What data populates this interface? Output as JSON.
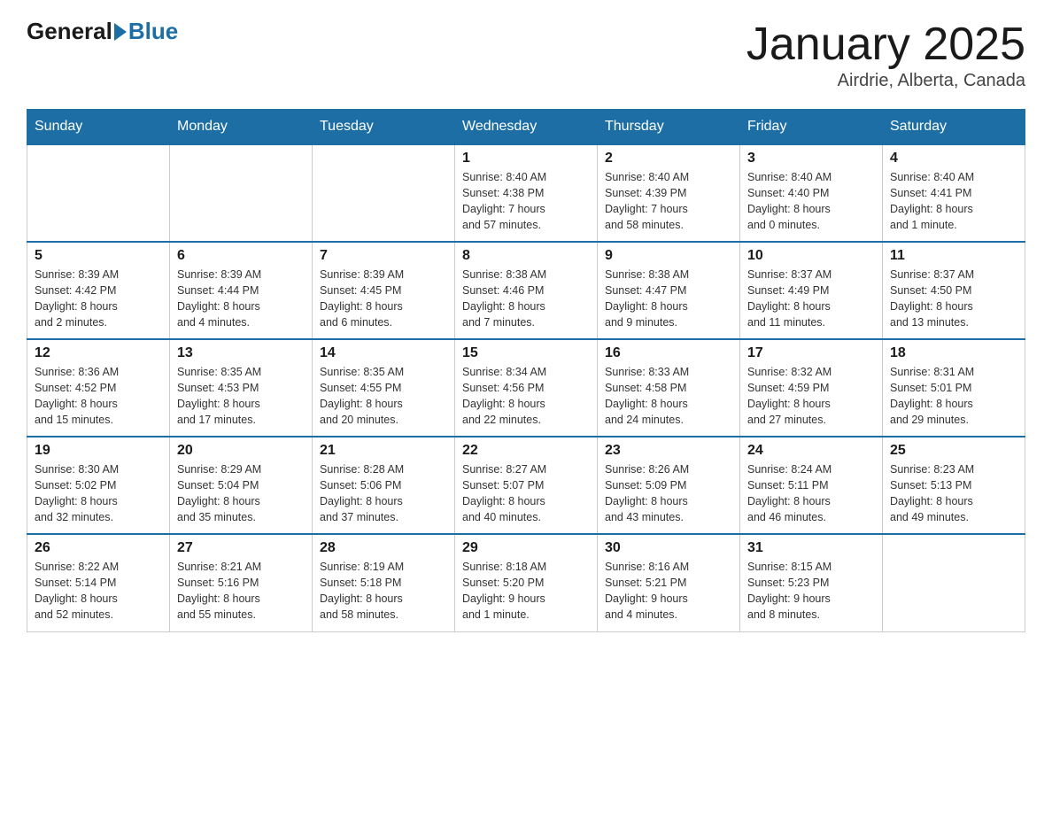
{
  "header": {
    "logo": {
      "general": "General",
      "blue": "Blue"
    },
    "title": "January 2025",
    "location": "Airdrie, Alberta, Canada"
  },
  "weekdays": [
    "Sunday",
    "Monday",
    "Tuesday",
    "Wednesday",
    "Thursday",
    "Friday",
    "Saturday"
  ],
  "weeks": [
    [
      {
        "day": "",
        "info": ""
      },
      {
        "day": "",
        "info": ""
      },
      {
        "day": "",
        "info": ""
      },
      {
        "day": "1",
        "info": "Sunrise: 8:40 AM\nSunset: 4:38 PM\nDaylight: 7 hours\nand 57 minutes."
      },
      {
        "day": "2",
        "info": "Sunrise: 8:40 AM\nSunset: 4:39 PM\nDaylight: 7 hours\nand 58 minutes."
      },
      {
        "day": "3",
        "info": "Sunrise: 8:40 AM\nSunset: 4:40 PM\nDaylight: 8 hours\nand 0 minutes."
      },
      {
        "day": "4",
        "info": "Sunrise: 8:40 AM\nSunset: 4:41 PM\nDaylight: 8 hours\nand 1 minute."
      }
    ],
    [
      {
        "day": "5",
        "info": "Sunrise: 8:39 AM\nSunset: 4:42 PM\nDaylight: 8 hours\nand 2 minutes."
      },
      {
        "day": "6",
        "info": "Sunrise: 8:39 AM\nSunset: 4:44 PM\nDaylight: 8 hours\nand 4 minutes."
      },
      {
        "day": "7",
        "info": "Sunrise: 8:39 AM\nSunset: 4:45 PM\nDaylight: 8 hours\nand 6 minutes."
      },
      {
        "day": "8",
        "info": "Sunrise: 8:38 AM\nSunset: 4:46 PM\nDaylight: 8 hours\nand 7 minutes."
      },
      {
        "day": "9",
        "info": "Sunrise: 8:38 AM\nSunset: 4:47 PM\nDaylight: 8 hours\nand 9 minutes."
      },
      {
        "day": "10",
        "info": "Sunrise: 8:37 AM\nSunset: 4:49 PM\nDaylight: 8 hours\nand 11 minutes."
      },
      {
        "day": "11",
        "info": "Sunrise: 8:37 AM\nSunset: 4:50 PM\nDaylight: 8 hours\nand 13 minutes."
      }
    ],
    [
      {
        "day": "12",
        "info": "Sunrise: 8:36 AM\nSunset: 4:52 PM\nDaylight: 8 hours\nand 15 minutes."
      },
      {
        "day": "13",
        "info": "Sunrise: 8:35 AM\nSunset: 4:53 PM\nDaylight: 8 hours\nand 17 minutes."
      },
      {
        "day": "14",
        "info": "Sunrise: 8:35 AM\nSunset: 4:55 PM\nDaylight: 8 hours\nand 20 minutes."
      },
      {
        "day": "15",
        "info": "Sunrise: 8:34 AM\nSunset: 4:56 PM\nDaylight: 8 hours\nand 22 minutes."
      },
      {
        "day": "16",
        "info": "Sunrise: 8:33 AM\nSunset: 4:58 PM\nDaylight: 8 hours\nand 24 minutes."
      },
      {
        "day": "17",
        "info": "Sunrise: 8:32 AM\nSunset: 4:59 PM\nDaylight: 8 hours\nand 27 minutes."
      },
      {
        "day": "18",
        "info": "Sunrise: 8:31 AM\nSunset: 5:01 PM\nDaylight: 8 hours\nand 29 minutes."
      }
    ],
    [
      {
        "day": "19",
        "info": "Sunrise: 8:30 AM\nSunset: 5:02 PM\nDaylight: 8 hours\nand 32 minutes."
      },
      {
        "day": "20",
        "info": "Sunrise: 8:29 AM\nSunset: 5:04 PM\nDaylight: 8 hours\nand 35 minutes."
      },
      {
        "day": "21",
        "info": "Sunrise: 8:28 AM\nSunset: 5:06 PM\nDaylight: 8 hours\nand 37 minutes."
      },
      {
        "day": "22",
        "info": "Sunrise: 8:27 AM\nSunset: 5:07 PM\nDaylight: 8 hours\nand 40 minutes."
      },
      {
        "day": "23",
        "info": "Sunrise: 8:26 AM\nSunset: 5:09 PM\nDaylight: 8 hours\nand 43 minutes."
      },
      {
        "day": "24",
        "info": "Sunrise: 8:24 AM\nSunset: 5:11 PM\nDaylight: 8 hours\nand 46 minutes."
      },
      {
        "day": "25",
        "info": "Sunrise: 8:23 AM\nSunset: 5:13 PM\nDaylight: 8 hours\nand 49 minutes."
      }
    ],
    [
      {
        "day": "26",
        "info": "Sunrise: 8:22 AM\nSunset: 5:14 PM\nDaylight: 8 hours\nand 52 minutes."
      },
      {
        "day": "27",
        "info": "Sunrise: 8:21 AM\nSunset: 5:16 PM\nDaylight: 8 hours\nand 55 minutes."
      },
      {
        "day": "28",
        "info": "Sunrise: 8:19 AM\nSunset: 5:18 PM\nDaylight: 8 hours\nand 58 minutes."
      },
      {
        "day": "29",
        "info": "Sunrise: 8:18 AM\nSunset: 5:20 PM\nDaylight: 9 hours\nand 1 minute."
      },
      {
        "day": "30",
        "info": "Sunrise: 8:16 AM\nSunset: 5:21 PM\nDaylight: 9 hours\nand 4 minutes."
      },
      {
        "day": "31",
        "info": "Sunrise: 8:15 AM\nSunset: 5:23 PM\nDaylight: 9 hours\nand 8 minutes."
      },
      {
        "day": "",
        "info": ""
      }
    ]
  ]
}
